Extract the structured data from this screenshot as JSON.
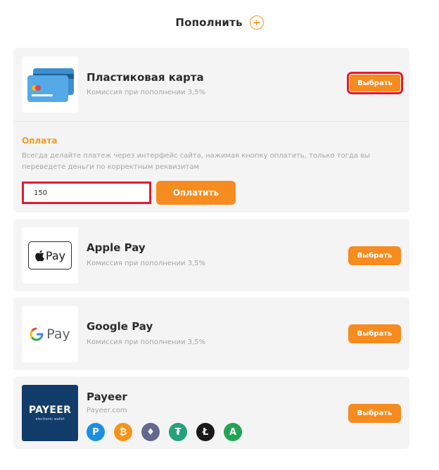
{
  "header": {
    "title": "Пополнить",
    "add_icon": "plus-circle-icon",
    "accent": "#f39a1e"
  },
  "methods": [
    {
      "name": "Пластиковая карта",
      "subtitle": "Комиссия при пополнении 3,5%",
      "select_label": "Выбрать",
      "icon": "credit-card-icon",
      "expanded": true
    },
    {
      "name": "Apple Pay",
      "subtitle": "Комиссия при пополнении 3,5%",
      "select_label": "Выбрать",
      "icon": "apple-pay-icon",
      "logo_text": "Pay"
    },
    {
      "name": "Google Pay",
      "subtitle": "Комиссия при пополнении 3,5%",
      "select_label": "Выбрать",
      "icon": "google-pay-icon",
      "logo_text": "Pay"
    },
    {
      "name": "Payeer",
      "subtitle": "Payeer.com",
      "select_label": "Выбрать",
      "icon": "payeer-logo",
      "logo_text": "PAYEER",
      "logo_subtext": "electronic wallet"
    }
  ],
  "payment": {
    "title": "Оплата",
    "note": "Всегда делайте платеж через интерфейс сайта, нажимая кнопку оплатить, только тогда вы переведете деньги по корректным реквизитам",
    "amount_value": "150",
    "pay_label": "Оплатить"
  },
  "currencies": [
    {
      "icon": "payeer-coin-icon",
      "glyph": "P",
      "color": "#1a8fe3"
    },
    {
      "icon": "bitcoin-icon",
      "glyph": "₿",
      "color": "#f7931a"
    },
    {
      "icon": "ethereum-icon",
      "glyph": "♦",
      "color": "#62688f"
    },
    {
      "icon": "tether-icon",
      "glyph": "₮",
      "color": "#26a17b"
    },
    {
      "icon": "litecoin-icon",
      "glyph": "Ł",
      "color": "#1a1a1a"
    },
    {
      "icon": "advcash-icon",
      "glyph": "A",
      "color": "#23a455"
    }
  ],
  "colors": {
    "button": "#f68b1f",
    "highlight": "#e31b2f",
    "card_bg": "#f4f4f4"
  }
}
